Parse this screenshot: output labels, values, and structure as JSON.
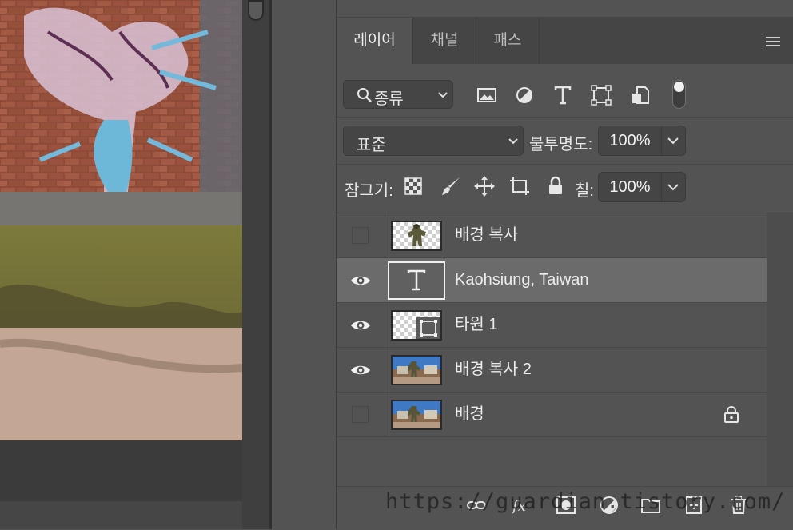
{
  "tabs": [
    {
      "label": "레이어",
      "active": true
    },
    {
      "label": "채널",
      "active": false
    },
    {
      "label": "패스",
      "active": false
    }
  ],
  "filter": {
    "kind_label": "종류",
    "icons": [
      "image-filter-icon",
      "adjustment-filter-icon",
      "type-filter-icon",
      "shape-filter-icon",
      "smart-object-filter-icon"
    ]
  },
  "blend": {
    "mode": "표준",
    "opacity_label": "불투명도:",
    "opacity": "100%"
  },
  "lock": {
    "label": "잠그기:",
    "fill_label": "칠:",
    "fill": "100%"
  },
  "layers": [
    {
      "name": "배경 복사",
      "visible": false,
      "thumb": "figure-cutout",
      "locked": false,
      "selected": false
    },
    {
      "name": "Kaohsiung, Taiwan",
      "visible": true,
      "thumb": "text",
      "locked": false,
      "selected": true
    },
    {
      "name": "타원 1",
      "visible": true,
      "thumb": "shape",
      "locked": false,
      "selected": false
    },
    {
      "name": "배경 복사 2",
      "visible": true,
      "thumb": "photo",
      "locked": false,
      "selected": false
    },
    {
      "name": "배경",
      "visible": false,
      "thumb": "photo",
      "locked": true,
      "selected": false
    }
  ],
  "bottom_icons": [
    "link-layers-icon",
    "fx-icon",
    "add-mask-icon",
    "adjustment-layer-icon",
    "group-icon",
    "new-layer-icon",
    "delete-icon"
  ],
  "watermark": "https://guardian.tistory.com/",
  "colors": {
    "panel_bg": "#535353",
    "selected_row": "#6b6b6b",
    "tab_bar": "#454545"
  }
}
